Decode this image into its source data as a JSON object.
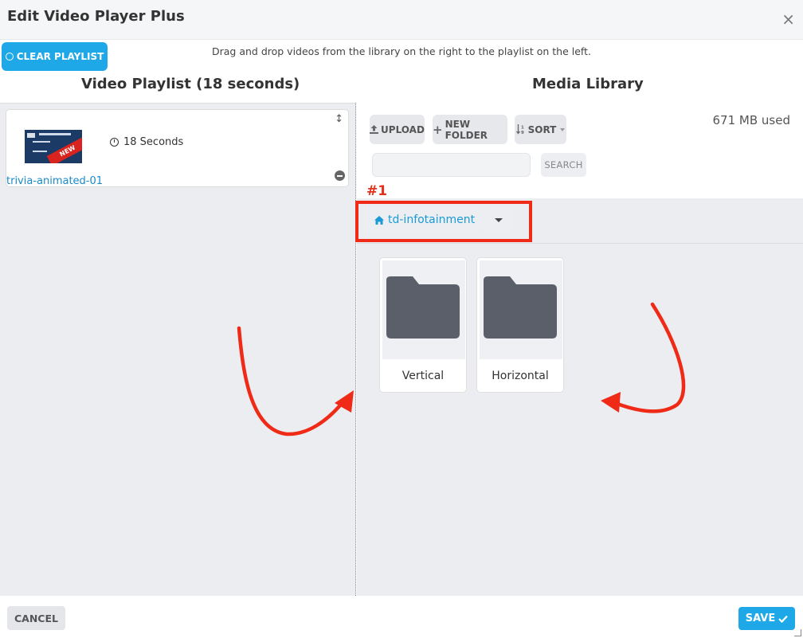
{
  "modal": {
    "title": "Edit Video Player Plus",
    "close_glyph": "×"
  },
  "toolbar": {
    "clear_label": "CLEAR PLAYLIST",
    "instructions": "Drag and drop videos from the library on the right to the playlist on the left."
  },
  "playlist": {
    "title": "Video Playlist (18 seconds)",
    "items": [
      {
        "name": "trivia-animated-01",
        "duration": "18 Seconds",
        "thumb_badge": "NEW"
      }
    ]
  },
  "library": {
    "title": "Media Library",
    "upload_label": "UPLOAD",
    "new_folder_label": "NEW FOLDER",
    "sort_label": "SORT",
    "usage": "671 MB used",
    "search_placeholder": "",
    "search_button": "SEARCH",
    "breadcrumb": "td-infotainment",
    "folders": [
      {
        "name": "Vertical"
      },
      {
        "name": "Horizontal"
      }
    ]
  },
  "annotation": {
    "label": "#1",
    "color": "#ef2a16"
  },
  "footer": {
    "cancel_label": "CANCEL",
    "save_label": "SAVE"
  },
  "colors": {
    "accent": "#1fa8e8",
    "link": "#1a9bd6",
    "folder": "#5a5f69",
    "panel_bg": "#ebedf1"
  }
}
